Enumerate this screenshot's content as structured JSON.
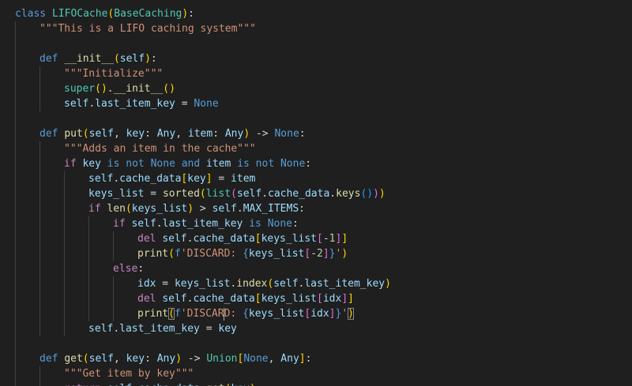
{
  "theme": {
    "background": "#1f1f1f",
    "guide": "#404040",
    "colors": {
      "kw": "#569cd6",
      "ctrl": "#c586c0",
      "fn": "#dcdcaa",
      "cls": "#4ec9b0",
      "str": "#ce9178",
      "num": "#b5cea8",
      "var": "#9cdcfe",
      "op": "#d4d4d4",
      "b1": "#ffd700",
      "b2": "#da70d6",
      "b3": "#179fff"
    }
  },
  "lines": [
    {
      "indent": 0,
      "tokens": [
        [
          "kw",
          "class"
        ],
        [
          "op",
          " "
        ],
        [
          "cls",
          "LIFOCache"
        ],
        [
          "b1",
          "("
        ],
        [
          "cls",
          "BaseCaching"
        ],
        [
          "b1",
          ")"
        ],
        [
          "op",
          ":"
        ]
      ]
    },
    {
      "indent": 1,
      "tokens": [
        [
          "str",
          "\"\"\"This is a LIFO caching system\"\"\""
        ]
      ]
    },
    {
      "indent": 0,
      "tokens": []
    },
    {
      "indent": 1,
      "tokens": [
        [
          "kw",
          "def"
        ],
        [
          "op",
          " "
        ],
        [
          "fn",
          "__init__"
        ],
        [
          "b1",
          "("
        ],
        [
          "var",
          "self"
        ],
        [
          "b1",
          ")"
        ],
        [
          "op",
          ":"
        ]
      ]
    },
    {
      "indent": 2,
      "tokens": [
        [
          "str",
          "\"\"\"Initialize\"\"\""
        ]
      ]
    },
    {
      "indent": 2,
      "tokens": [
        [
          "cls",
          "super"
        ],
        [
          "b1",
          "("
        ],
        [
          "b1",
          ")"
        ],
        [
          "op",
          "."
        ],
        [
          "fn",
          "__init__"
        ],
        [
          "b1",
          "("
        ],
        [
          "b1",
          ")"
        ]
      ]
    },
    {
      "indent": 2,
      "tokens": [
        [
          "var",
          "self"
        ],
        [
          "op",
          "."
        ],
        [
          "var",
          "last_item_key"
        ],
        [
          "op",
          " = "
        ],
        [
          "kw",
          "None"
        ]
      ]
    },
    {
      "indent": 0,
      "tokens": []
    },
    {
      "indent": 1,
      "tokens": [
        [
          "kw",
          "def"
        ],
        [
          "op",
          " "
        ],
        [
          "fn",
          "put"
        ],
        [
          "b1",
          "("
        ],
        [
          "var",
          "self"
        ],
        [
          "op",
          ", "
        ],
        [
          "var",
          "key"
        ],
        [
          "op",
          ": "
        ],
        [
          "var",
          "Any"
        ],
        [
          "op",
          ", "
        ],
        [
          "var",
          "item"
        ],
        [
          "op",
          ": "
        ],
        [
          "var",
          "Any"
        ],
        [
          "b1",
          ")"
        ],
        [
          "op",
          " -> "
        ],
        [
          "kw",
          "None"
        ],
        [
          "op",
          ":"
        ]
      ]
    },
    {
      "indent": 2,
      "tokens": [
        [
          "str",
          "\"\"\"Adds an item in the cache\"\"\""
        ]
      ]
    },
    {
      "indent": 2,
      "tokens": [
        [
          "ctrl",
          "if"
        ],
        [
          "op",
          " "
        ],
        [
          "var",
          "key"
        ],
        [
          "op",
          " "
        ],
        [
          "kw",
          "is"
        ],
        [
          "op",
          " "
        ],
        [
          "kw",
          "not"
        ],
        [
          "op",
          " "
        ],
        [
          "kw",
          "None"
        ],
        [
          "op",
          " "
        ],
        [
          "kw",
          "and"
        ],
        [
          "op",
          " "
        ],
        [
          "var",
          "item"
        ],
        [
          "op",
          " "
        ],
        [
          "kw",
          "is"
        ],
        [
          "op",
          " "
        ],
        [
          "kw",
          "not"
        ],
        [
          "op",
          " "
        ],
        [
          "kw",
          "None"
        ],
        [
          "op",
          ":"
        ]
      ]
    },
    {
      "indent": 3,
      "tokens": [
        [
          "var",
          "self"
        ],
        [
          "op",
          "."
        ],
        [
          "var",
          "cache_data"
        ],
        [
          "b1",
          "["
        ],
        [
          "var",
          "key"
        ],
        [
          "b1",
          "]"
        ],
        [
          "op",
          " = "
        ],
        [
          "var",
          "item"
        ]
      ]
    },
    {
      "indent": 3,
      "tokens": [
        [
          "var",
          "keys_list"
        ],
        [
          "op",
          " = "
        ],
        [
          "fn",
          "sorted"
        ],
        [
          "b1",
          "("
        ],
        [
          "cls",
          "list"
        ],
        [
          "b2",
          "("
        ],
        [
          "var",
          "self"
        ],
        [
          "op",
          "."
        ],
        [
          "var",
          "cache_data"
        ],
        [
          "op",
          "."
        ],
        [
          "fn",
          "keys"
        ],
        [
          "b3",
          "("
        ],
        [
          "b3",
          ")"
        ],
        [
          "b2",
          ")"
        ],
        [
          "b1",
          ")"
        ]
      ]
    },
    {
      "indent": 3,
      "tokens": [
        [
          "ctrl",
          "if"
        ],
        [
          "op",
          " "
        ],
        [
          "fn",
          "len"
        ],
        [
          "b1",
          "("
        ],
        [
          "var",
          "keys_list"
        ],
        [
          "b1",
          ")"
        ],
        [
          "op",
          " > "
        ],
        [
          "var",
          "self"
        ],
        [
          "op",
          "."
        ],
        [
          "var",
          "MAX_ITEMS"
        ],
        [
          "op",
          ":"
        ]
      ]
    },
    {
      "indent": 4,
      "tokens": [
        [
          "ctrl",
          "if"
        ],
        [
          "op",
          " "
        ],
        [
          "var",
          "self"
        ],
        [
          "op",
          "."
        ],
        [
          "var",
          "last_item_key"
        ],
        [
          "op",
          " "
        ],
        [
          "kw",
          "is"
        ],
        [
          "op",
          " "
        ],
        [
          "kw",
          "None"
        ],
        [
          "op",
          ":"
        ]
      ]
    },
    {
      "indent": 5,
      "tokens": [
        [
          "ctrl",
          "del"
        ],
        [
          "op",
          " "
        ],
        [
          "var",
          "self"
        ],
        [
          "op",
          "."
        ],
        [
          "var",
          "cache_data"
        ],
        [
          "b1",
          "["
        ],
        [
          "var",
          "keys_list"
        ],
        [
          "b2",
          "["
        ],
        [
          "op",
          "-"
        ],
        [
          "num",
          "1"
        ],
        [
          "b2",
          "]"
        ],
        [
          "b1",
          "]"
        ]
      ]
    },
    {
      "indent": 5,
      "tokens": [
        [
          "fn",
          "print"
        ],
        [
          "b1",
          "("
        ],
        [
          "kw",
          "f"
        ],
        [
          "str",
          "'DISCARD: "
        ],
        [
          "kw",
          "{"
        ],
        [
          "var",
          "keys_list"
        ],
        [
          "b2",
          "["
        ],
        [
          "op",
          "-"
        ],
        [
          "num",
          "2"
        ],
        [
          "b2",
          "]"
        ],
        [
          "kw",
          "}"
        ],
        [
          "str",
          "'"
        ],
        [
          "b1",
          ")"
        ]
      ]
    },
    {
      "indent": 4,
      "tokens": [
        [
          "ctrl",
          "else"
        ],
        [
          "op",
          ":"
        ]
      ]
    },
    {
      "indent": 5,
      "tokens": [
        [
          "var",
          "idx"
        ],
        [
          "op",
          " = "
        ],
        [
          "var",
          "keys_list"
        ],
        [
          "op",
          "."
        ],
        [
          "fn",
          "index"
        ],
        [
          "b1",
          "("
        ],
        [
          "var",
          "self"
        ],
        [
          "op",
          "."
        ],
        [
          "var",
          "last_item_key"
        ],
        [
          "b1",
          ")"
        ]
      ]
    },
    {
      "indent": 5,
      "tokens": [
        [
          "ctrl",
          "del"
        ],
        [
          "op",
          " "
        ],
        [
          "var",
          "self"
        ],
        [
          "op",
          "."
        ],
        [
          "var",
          "cache_data"
        ],
        [
          "b1",
          "["
        ],
        [
          "var",
          "keys_list"
        ],
        [
          "b2",
          "["
        ],
        [
          "var",
          "idx"
        ],
        [
          "b2",
          "]"
        ],
        [
          "b1",
          "]"
        ]
      ]
    },
    {
      "indent": 5,
      "tokens": [
        [
          "fn",
          "print"
        ],
        [
          "b1",
          "(",
          "match"
        ],
        [
          "kw",
          "f"
        ],
        [
          "str",
          "'DISCAR"
        ],
        [
          "cursor",
          ""
        ],
        [
          "str",
          "D: "
        ],
        [
          "kw",
          "{"
        ],
        [
          "var",
          "keys_list"
        ],
        [
          "b2",
          "["
        ],
        [
          "var",
          "idx"
        ],
        [
          "b2",
          "]"
        ],
        [
          "kw",
          "}"
        ],
        [
          "str",
          "'"
        ],
        [
          "b1",
          ")",
          "match"
        ]
      ]
    },
    {
      "indent": 3,
      "tokens": [
        [
          "var",
          "self"
        ],
        [
          "op",
          "."
        ],
        [
          "var",
          "last_item_key"
        ],
        [
          "op",
          " = "
        ],
        [
          "var",
          "key"
        ]
      ]
    },
    {
      "indent": 0,
      "tokens": []
    },
    {
      "indent": 1,
      "tokens": [
        [
          "kw",
          "def"
        ],
        [
          "op",
          " "
        ],
        [
          "fn",
          "get"
        ],
        [
          "b1",
          "("
        ],
        [
          "var",
          "self"
        ],
        [
          "op",
          ", "
        ],
        [
          "var",
          "key"
        ],
        [
          "op",
          ": "
        ],
        [
          "var",
          "Any"
        ],
        [
          "b1",
          ")"
        ],
        [
          "op",
          " -> "
        ],
        [
          "cls",
          "Union"
        ],
        [
          "b1",
          "["
        ],
        [
          "kw",
          "None"
        ],
        [
          "op",
          ", "
        ],
        [
          "var",
          "Any"
        ],
        [
          "b1",
          "]"
        ],
        [
          "op",
          ":"
        ]
      ]
    },
    {
      "indent": 2,
      "tokens": [
        [
          "str",
          "\"\"\"Get item by key\"\"\""
        ]
      ]
    },
    {
      "indent": 2,
      "tokens": [
        [
          "ctrl",
          "return"
        ],
        [
          "op",
          " "
        ],
        [
          "var",
          "self"
        ],
        [
          "op",
          "."
        ],
        [
          "var",
          "cache_data"
        ],
        [
          "op",
          "."
        ],
        [
          "fn",
          "get"
        ],
        [
          "b1",
          "("
        ],
        [
          "var",
          "key"
        ],
        [
          "b1",
          ")"
        ]
      ]
    }
  ]
}
